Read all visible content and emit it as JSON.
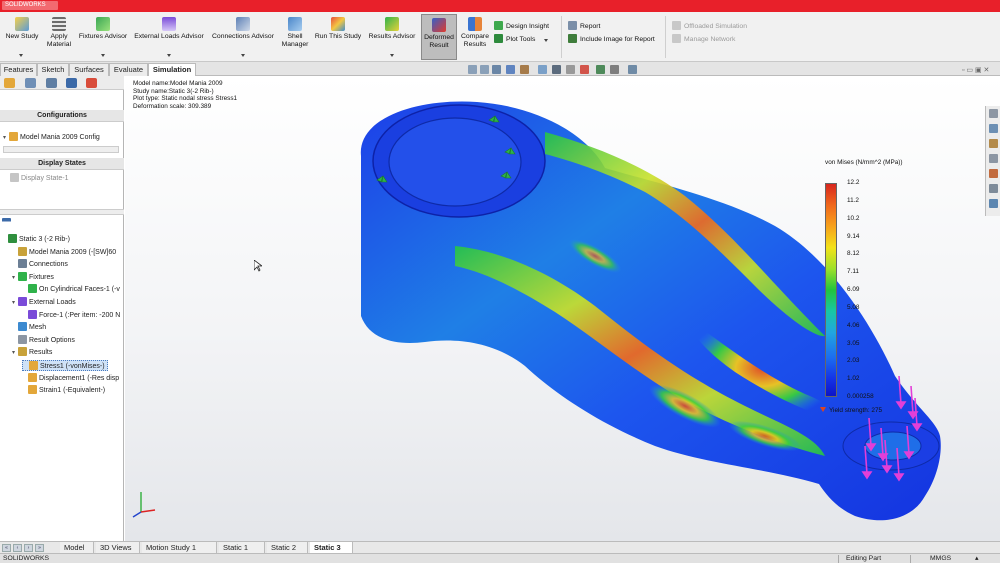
{
  "app": {
    "brand": "SOLIDWORKS"
  },
  "ribbon": {
    "new_study": "New Study",
    "apply_material": [
      "Apply",
      "Material"
    ],
    "fixtures_advisor": "Fixtures Advisor",
    "external_loads_advisor": "External Loads Advisor",
    "connections_advisor": "Connections Advisor",
    "shell_manager": [
      "Shell",
      "Manager"
    ],
    "run_this_study": "Run This Study",
    "results_advisor": "Results Advisor",
    "deformed_result": [
      "Deformed",
      "Result"
    ],
    "compare_results": [
      "Compare",
      "Results"
    ],
    "design_insight": "Design Insight",
    "plot_tools": "Plot Tools",
    "report": "Report",
    "include_image": "Include Image for Report",
    "offloaded_simulation": "Offloaded Simulation",
    "manage_network": "Manage Network"
  },
  "tabs": [
    "Features",
    "Sketch",
    "Surfaces",
    "Evaluate",
    "Simulation"
  ],
  "left_panel": {
    "configurations_title": "Configurations",
    "config_item": "Model Mania 2009 Config",
    "display_states_title": "Display States",
    "display_state_item": "Display State-1",
    "tree": [
      {
        "label": "Static 3 (-2 Rib-)",
        "indent": 0,
        "expand": ""
      },
      {
        "label": "Model Mania 2009 (-[SW]60",
        "indent": 1,
        "expand": ""
      },
      {
        "label": "Connections",
        "indent": 1,
        "expand": ""
      },
      {
        "label": "Fixtures",
        "indent": 1,
        "expand": "▾"
      },
      {
        "label": "On Cylindrical Faces-1 (-v",
        "indent": 2,
        "expand": ""
      },
      {
        "label": "External Loads",
        "indent": 1,
        "expand": "▾"
      },
      {
        "label": "Force-1 (:Per item: -200 N",
        "indent": 2,
        "expand": ""
      },
      {
        "label": "Mesh",
        "indent": 1,
        "expand": ""
      },
      {
        "label": "Result Options",
        "indent": 1,
        "expand": ""
      },
      {
        "label": "Results",
        "indent": 1,
        "expand": "▾"
      },
      {
        "label": "Stress1 (-vonMises-)",
        "indent": 2,
        "expand": "",
        "selected": true
      },
      {
        "label": "Displacement1 (-Res disp",
        "indent": 2,
        "expand": ""
      },
      {
        "label": "Strain1 (-Equivalent-)",
        "indent": 2,
        "expand": ""
      }
    ]
  },
  "plot_info": [
    "Model name:Model Mania 2009",
    "Study name:Static 3(-2 Rib-)",
    "Plot type: Static nodal stress Stress1",
    "Deformation scale: 309.389"
  ],
  "legend": {
    "title": "von Mises (N/mm^2 (MPa))",
    "ticks": [
      "12.2",
      "11.2",
      "10.2",
      "9.14",
      "8.12",
      "7.11",
      "6.09",
      "5.08",
      "4.06",
      "3.05",
      "2.03",
      "1.02",
      "0.000258"
    ],
    "yield": "Yield strength: 275"
  },
  "bottom_tabs": [
    "Model",
    "3D Views",
    "Motion Study 1",
    "Static 1",
    "Static 2",
    "Static 3"
  ],
  "status": {
    "app": "SOLIDWORKS",
    "mode": "Editing Part",
    "units": "MMGS"
  },
  "colors": {
    "title_bar": "#e8202a",
    "stress_low": "#0c14c8",
    "stress_high": "#d7261e",
    "load_arrows": "#e23fd8",
    "fixture_arrows": "#2fb24a"
  }
}
